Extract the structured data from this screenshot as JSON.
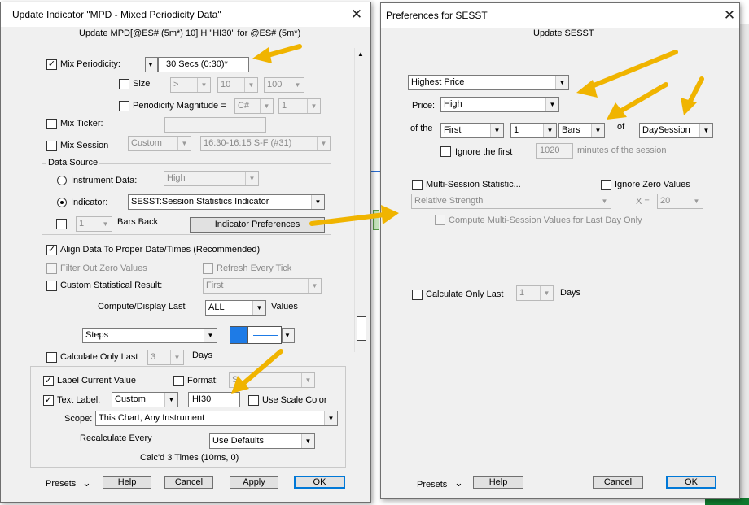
{
  "left": {
    "title": "Update Indicator \"MPD - Mixed Periodicity Data\"",
    "subtitle": "Update MPD[@ES# (5m*) 10] H \"HI30\" for @ES# (5m*)",
    "mix_periodicity": {
      "label": "Mix Periodicity:",
      "value": "30 Secs (0:30)*"
    },
    "size": {
      "label": "Size",
      "op": ">",
      "v1": "10",
      "v2": "100"
    },
    "periodicity_magnitude": {
      "label": "Periodicity Magnitude =",
      "unit": "C#",
      "value": "1"
    },
    "mix_ticker": {
      "label": "Mix Ticker:"
    },
    "mix_session": {
      "label": "Mix Session",
      "value": "Custom",
      "range": "16:30-16:15 S-F (#31)"
    },
    "data_source": {
      "legend": "Data Source",
      "instrument_label": "Instrument Data:",
      "instrument_value": "High",
      "indicator_label": "Indicator:",
      "indicator_value": "SESST:Session Statistics Indicator",
      "bars_back_value": "1",
      "bars_back_label": "Bars Back",
      "prefs_button": "Indicator Preferences"
    },
    "align": "Align Data To Proper Date/Times (Recommended)",
    "filter_zero": "Filter Out Zero Values",
    "refresh_tick": "Refresh Every Tick",
    "custom_stat": {
      "label": "Custom Statistical Result:",
      "value": "First"
    },
    "compute": {
      "label": "Compute/Display Last",
      "value": "ALL",
      "suffix": "Values"
    },
    "style": {
      "value": "Steps"
    },
    "calc_last": {
      "label": "Calculate Only Last",
      "value": "3",
      "suffix": "Days"
    },
    "label_current": "Label Current Value",
    "format": {
      "label": "Format:",
      "value": "S"
    },
    "text_label": {
      "label": "Text Label:",
      "mode": "Custom",
      "value": "HI30"
    },
    "use_scale_color": "Use Scale Color",
    "scope": {
      "label": "Scope:",
      "value": "This Chart, Any Instrument"
    },
    "recalc": {
      "label": "Recalculate Every",
      "value": "Use Defaults"
    },
    "calcd": "Calc'd 3 Times (10ms, 0)",
    "buttons": {
      "presets": "Presets",
      "help": "Help",
      "cancel": "Cancel",
      "apply": "Apply",
      "ok": "OK"
    }
  },
  "right": {
    "title": "Preferences for SESST",
    "subtitle": "Update SESST",
    "stat": "Highest Price",
    "price_label": "Price:",
    "price_value": "High",
    "of_the": "of the",
    "first": "First",
    "count": "1",
    "unit": "Bars",
    "of": "of",
    "session": "DaySession",
    "ignore_first": "Ignore the first",
    "ignore_value": "1020",
    "ignore_suffix": "minutes of the session",
    "multi_session": "Multi-Session Statistic...",
    "ignore_zero": "Ignore Zero Values",
    "relative_strength": "Relative Strength",
    "x_label": "X =",
    "x_value": "20",
    "compute_multi": "Compute Multi-Session Values for Last Day Only",
    "calc_last": {
      "label": "Calculate Only Last",
      "value": "1",
      "suffix": "Days"
    },
    "buttons": {
      "presets": "Presets",
      "help": "Help",
      "cancel": "Cancel",
      "ok": "OK"
    }
  },
  "icons": {
    "close": "close-icon",
    "dropdown": "chevron-down-icon",
    "check": "checkmark-icon",
    "arrow": "annotation-arrow-icon"
  },
  "colors": {
    "arrow": "#f0b400",
    "accent": "#0078d7",
    "line_color": "#1e7be6"
  }
}
